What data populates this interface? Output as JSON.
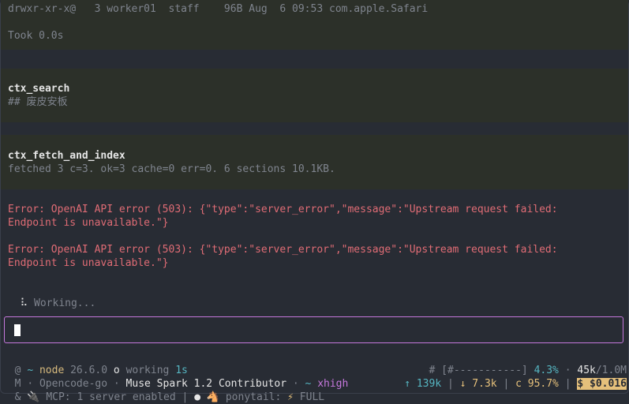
{
  "output": {
    "ls_line": "drwxr-xr-x@   3 worker01  staff    96B Aug  6 09:53 com.apple.Safari",
    "took": "Took 0.0s",
    "ctx_search": {
      "title": "ctx_search",
      "detail": "## 废皮安板"
    },
    "ctx_fetch": {
      "title": "ctx_fetch_and_index",
      "detail": "fetched 3 c=3. ok=3 cache=0 err=0. 6 sections 10.1KB."
    },
    "errors": [
      {
        "line1": "Error: OpenAI API error (503): {\"type\":\"server_error\",\"message\":\"Upstream request failed:",
        "line2": "Endpoint is unavailable.\"}"
      },
      {
        "line1": "Error: OpenAI API error (503): {\"type\":\"server_error\",\"message\":\"Upstream request failed:",
        "line2": "Endpoint is unavailable.\"}"
      }
    ],
    "working": {
      "spinner": "⠧",
      "text": "Working..."
    }
  },
  "input": {
    "value": ""
  },
  "status": {
    "row1": {
      "prefix": "@",
      "tilde": "~",
      "runtime": "node",
      "version": "26.6.0",
      "o": "o",
      "state": "working",
      "elapsed": "1s",
      "hash": "#",
      "progress": "[#-----------]",
      "percent": "4.3%",
      "sep": "·",
      "tokens": "45k",
      "token_limit": "/1.0M"
    },
    "row2": {
      "prefix": "M",
      "provider": "Opencode-go",
      "model": "Muse Spark 1.2 Contributor",
      "tilde": "~",
      "effort": "xhigh",
      "up": "↑ 139k",
      "down": "↓ 7.3k",
      "cache": "c 95.7%",
      "cost": "$ $0.016"
    },
    "row3": {
      "prefix": "&",
      "plug": "🔌",
      "mcp": "MCP: 1 server enabled",
      "dot": "●",
      "pony_icon": "🐴",
      "pony": "ponytail:",
      "bolt": "⚡",
      "mode": "FULL"
    }
  }
}
